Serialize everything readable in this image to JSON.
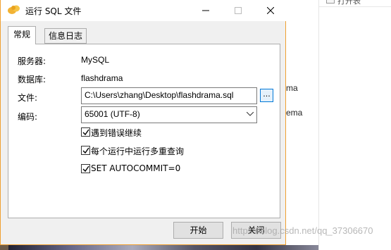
{
  "background": {
    "top_clip_text": "打开表",
    "behind_texts": [
      "ma",
      "ema"
    ]
  },
  "dialog": {
    "title": "运行 SQL 文件",
    "tabs": [
      {
        "label": "常规",
        "active": true
      },
      {
        "label": "信息日志",
        "active": false
      }
    ],
    "server_label": "服务器:",
    "server_value": "MySQL",
    "database_label": "数据库:",
    "database_value": "flashdrama",
    "file_label": "文件:",
    "file_value": "C:\\Users\\zhang\\Desktop\\flashdrama.sql",
    "browse_label": "...",
    "encoding_label": "编码:",
    "encoding_value": "65001 (UTF-8)",
    "options": [
      {
        "label": "遇到错误继续",
        "checked": true
      },
      {
        "label": "每个运行中运行多重查询",
        "checked": true
      },
      {
        "label": "SET AUTOCOMMIT=0",
        "checked": true
      }
    ],
    "start_button": "开始",
    "close_button": "关闭"
  },
  "watermark": "https://blog.csdn.net/qq_37306670",
  "colors": {
    "dialog_border": "#f0a030",
    "accent_blue": "#0078d7",
    "button_bg": "#e1e1e1"
  }
}
